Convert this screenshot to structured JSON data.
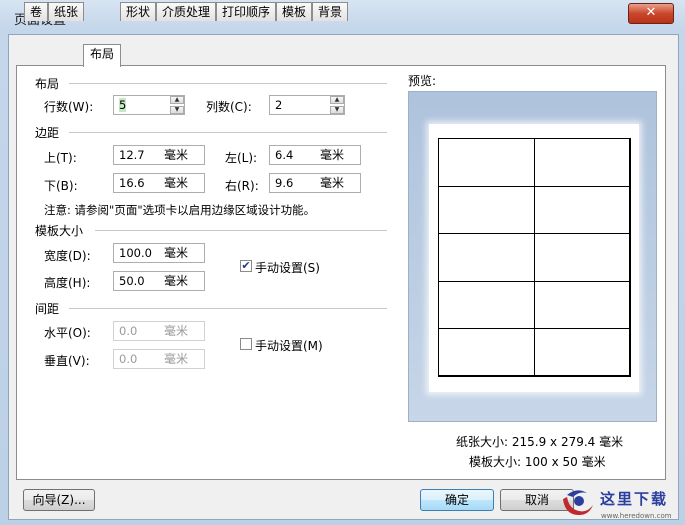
{
  "window": {
    "title": "页面设置",
    "close_label": "✕"
  },
  "tabs": [
    "卷",
    "纸张",
    "布局",
    "形状",
    "介质处理",
    "打印顺序",
    "模板",
    "背景"
  ],
  "active_tab": "布局",
  "layout": {
    "title": "布局",
    "rows_label": "行数(W):",
    "rows_value": "5",
    "cols_label": "列数(C):",
    "cols_value": "2"
  },
  "margins": {
    "title": "边距",
    "top_label": "上(T):",
    "top_value": "12.7",
    "left_label": "左(L):",
    "left_value": "6.4",
    "bottom_label": "下(B):",
    "bottom_value": "16.6",
    "right_label": "右(R):",
    "right_value": "9.6",
    "unit": "毫米",
    "note": "注意: 请参阅\"页面\"选项卡以启用边缘区域设计功能。"
  },
  "template_size": {
    "title": "模板大小",
    "width_label": "宽度(D):",
    "width_value": "100.0",
    "height_label": "高度(H):",
    "height_value": "50.0",
    "unit": "毫米",
    "manual_label": "手动设置(S)",
    "manual_checked": true
  },
  "spacing": {
    "title": "间距",
    "horizontal_label": "水平(O):",
    "horizontal_value": "0.0",
    "vertical_label": "垂直(V):",
    "vertical_value": "0.0",
    "unit": "毫米",
    "manual_label": "手动设置(M)",
    "manual_checked": false
  },
  "preview": {
    "title": "预览:",
    "paper_size": "纸张大小: 215.9 x 279.4 毫米",
    "template_size": "模板大小: 100 x 50 毫米",
    "rows": 5,
    "cols": 2
  },
  "buttons": {
    "wizard": "向导(Z)...",
    "ok": "确定",
    "cancel": "取消"
  },
  "watermark": {
    "text": "这里下载",
    "url": "www.heredown.com"
  }
}
